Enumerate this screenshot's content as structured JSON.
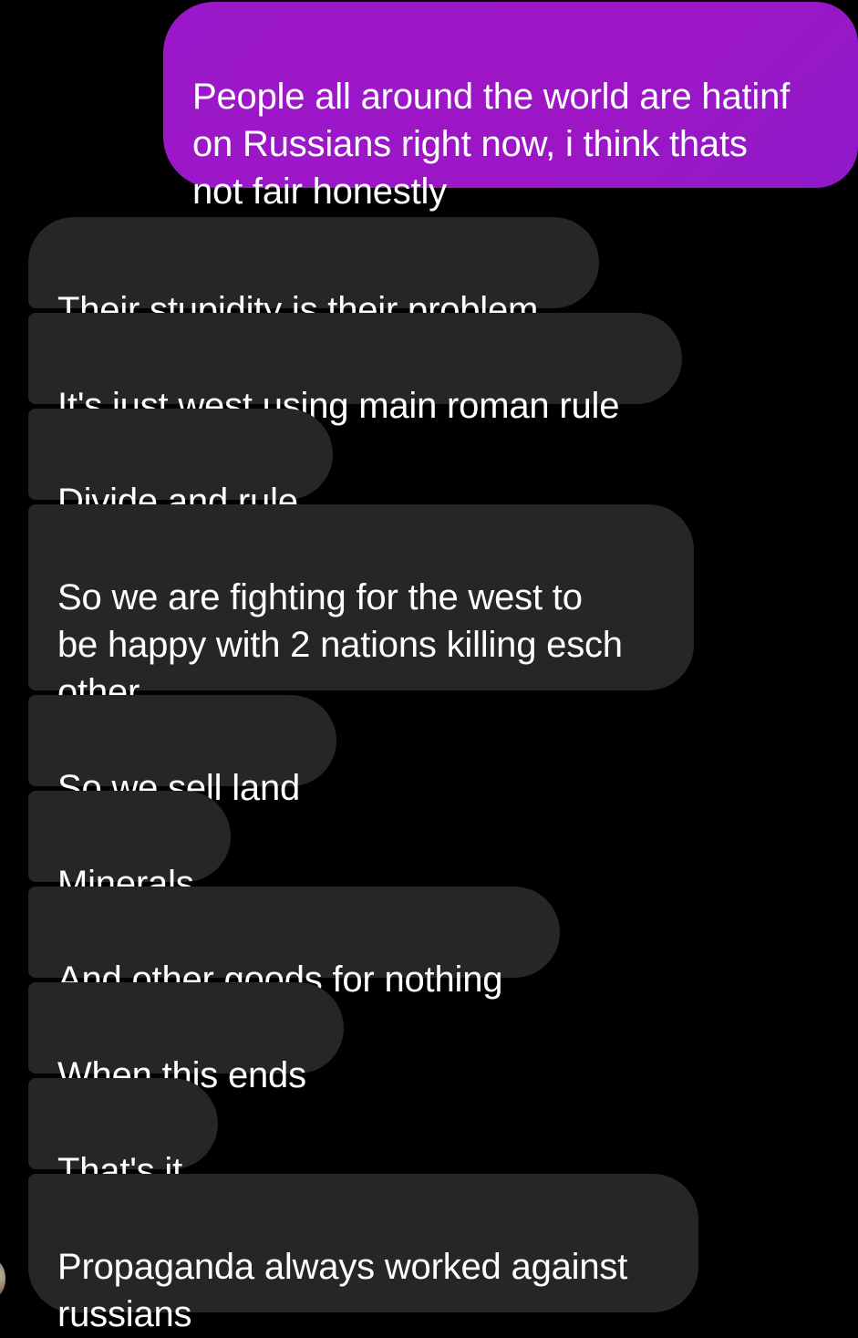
{
  "conversation": {
    "outgoing": [
      {
        "text": "People all around the world are hatinf\non Russians right now, i think thats\nnot fair honestly"
      }
    ],
    "incoming": [
      {
        "text": "Their stupidity is their problem"
      },
      {
        "text": "It's just west using main roman rule"
      },
      {
        "text": "Divide and rule"
      },
      {
        "text": "So we are fighting for the west to\nbe happy with 2 nations killing esch\nother"
      },
      {
        "text": "So we sell land"
      },
      {
        "text": "Minerals"
      },
      {
        "text": "And other goods for nothing"
      },
      {
        "text": "When this ends"
      },
      {
        "text": "That's it"
      },
      {
        "text": "Propaganda always worked against\nrussians"
      }
    ]
  },
  "colors": {
    "background": "#000000",
    "outgoing_bubble": "#9a18c9",
    "incoming_bubble": "#262626",
    "text": "#ffffff"
  }
}
